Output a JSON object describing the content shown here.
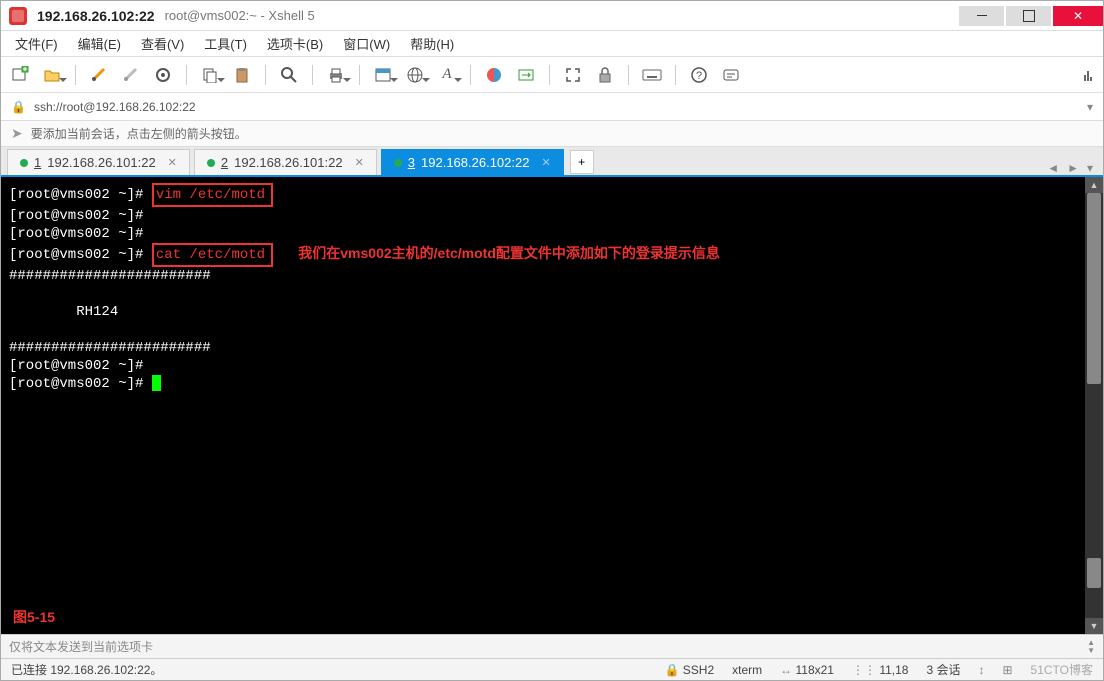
{
  "title": {
    "main": "192.168.26.102:22",
    "sub": "root@vms002:~ - Xshell 5"
  },
  "menu": {
    "file": "文件(F)",
    "edit": "编辑(E)",
    "view": "查看(V)",
    "tools": "工具(T)",
    "tabs": "选项卡(B)",
    "window": "窗口(W)",
    "help": "帮助(H)"
  },
  "address": {
    "url": "ssh://root@192.168.26.102:22"
  },
  "hint": {
    "text": "要添加当前会话，点击左侧的箭头按钮。"
  },
  "tabs": [
    {
      "num": "1",
      "label": "192.168.26.101:22",
      "active": false
    },
    {
      "num": "2",
      "label": "192.168.26.101:22",
      "active": false
    },
    {
      "num": "3",
      "label": "192.168.26.102:22",
      "active": true
    }
  ],
  "terminal": {
    "prompt": "[root@vms002 ~]#",
    "cmd1": "vim /etc/motd",
    "cmd2": "cat /etc/motd",
    "annotation": "我们在vms002主机的/etc/motd配置文件中添加如下的登录提示信息",
    "hashline": "########################",
    "motd_body": "        RH124",
    "fig": "图5-15"
  },
  "inputbar": {
    "placeholder": "仅将文本发送到当前选项卡"
  },
  "status": {
    "left": "已连接 192.168.26.102:22。",
    "proto": "SSH2",
    "term": "xterm",
    "size": "118x21",
    "pos": "11,18",
    "sess": "3 会话",
    "watermark": "51CTO博客"
  }
}
